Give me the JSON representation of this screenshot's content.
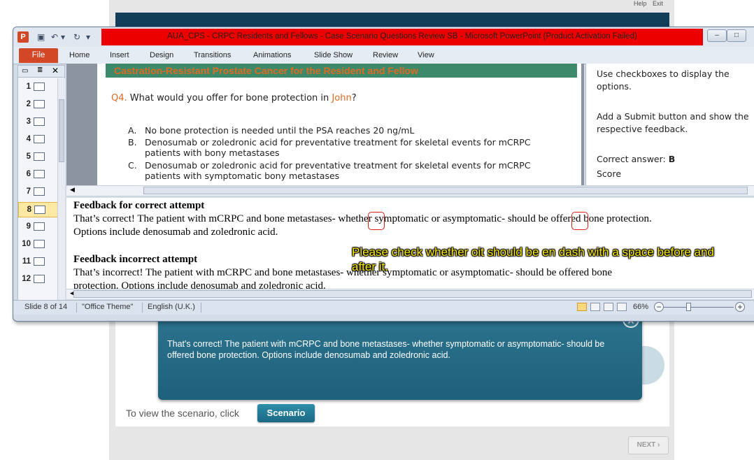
{
  "background": {
    "top_links": [
      "Help",
      "Exit"
    ],
    "popup": {
      "title": "That's correct!",
      "close_icon": "close-icon",
      "body": "That's correct! The patient with mCRPC and bone metastases- whether symptomatic or asymptomatic- should be offered bone protection. Options include denosumab and zoledronic acid."
    },
    "scenario_text": "To view the scenario, click",
    "scenario_button": "Scenario",
    "next_button": "NEXT ›"
  },
  "window": {
    "title": "AUA_CPS - CRPC Residents and  Fellows - Case Scenario Questions Review SB  -  Microsoft PowerPoint (Product Activation Failed)",
    "app_icon_label": "P",
    "title_color": "#ec0000"
  },
  "ribbon": {
    "file_tab": "File",
    "tabs": [
      "Home",
      "Insert",
      "Design",
      "Transitions",
      "Animations",
      "Slide Show",
      "Review",
      "View"
    ]
  },
  "thumbnails": {
    "slides": [
      "1",
      "2",
      "3",
      "4",
      "5",
      "6",
      "7",
      "8",
      "9",
      "10",
      "11",
      "12"
    ],
    "selected": "8"
  },
  "slide": {
    "header": "Castration-Resistant Prostate Cancer for the Resident and Fellow",
    "question_label": "Q4.",
    "question_text": "What would you offer for bone protection in",
    "question_name": "John",
    "question_end": "?",
    "options": [
      {
        "letter": "A.",
        "text": "No bone protection is needed until the PSA reaches 20 ng/mL"
      },
      {
        "letter": "B.",
        "text": "Denosumab or zoledronic acid for preventative treatment for skeletal events for mCRPC patients with bony metastases"
      },
      {
        "letter": "C.",
        "text": "Denosumab or zoledronic acid for preventative treatment for skeletal events for mCRPC patients with symptomatic bony metastases"
      }
    ]
  },
  "side_notes": {
    "p1": "Use checkboxes to display the options.",
    "p2": "Add a Submit button and show the respective feedback.",
    "p3_label": "Correct answer:",
    "p3_value": "B",
    "p4": "Score"
  },
  "notes": {
    "correct_head": "Feedback for correct attempt",
    "correct_line1": "That’s correct!  The patient with mCRPC and bone metastases-  whether symptomatic or asymptomatic-  should be offered bone protection.",
    "correct_line2": "Options include denosumab and zoledronic acid.",
    "incorrect_head": "Feedback incorrect attempt",
    "incorrect_line1": "That’s incorrect!  The patient with mCRPC and bone metastases-  whether symptomatic or asymptomatic- should be offered bone",
    "incorrect_line2": "protection.  Options include denosumab and zoledronic acid."
  },
  "annotation": {
    "text": "Please check whether oit should be en dash with a space before and after it."
  },
  "status": {
    "slide_info": "Slide 8 of 14",
    "theme": "\"Office Theme\"",
    "language": "English (U.K.)",
    "zoom": "66%"
  }
}
